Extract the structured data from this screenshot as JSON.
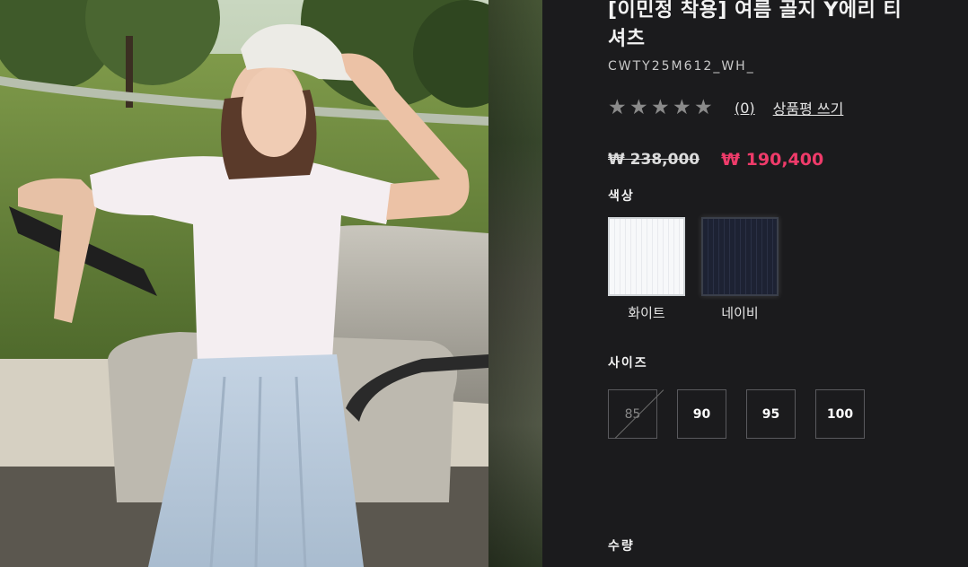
{
  "product": {
    "title": "[이민정 착용] 여름 골지 Y에리 티\n셔츠",
    "code": "CWTY25M612_WH_",
    "rating_stars": 0,
    "review_count": "(0)",
    "write_review_label": "상품평 쓰기",
    "original_price": "₩ 238,000",
    "sale_price": "₩ 190,400",
    "sale_color": "#ef3b6a"
  },
  "color_section": {
    "label": "색상",
    "options": [
      {
        "name": "화이트",
        "swatch": "white"
      },
      {
        "name": "네이비",
        "swatch": "navy"
      }
    ]
  },
  "size_section": {
    "label": "사이즈",
    "options": [
      {
        "label": "85",
        "sold_out": true
      },
      {
        "label": "90",
        "sold_out": false
      },
      {
        "label": "95",
        "sold_out": false
      },
      {
        "label": "100",
        "sold_out": false
      }
    ]
  },
  "quantity_section": {
    "label": "수량"
  },
  "icons": {
    "star": "star-icon"
  }
}
